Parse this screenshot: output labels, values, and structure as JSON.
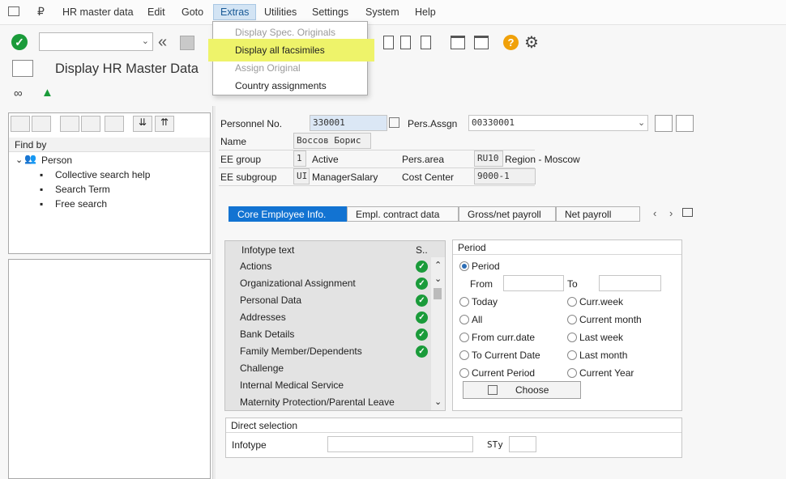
{
  "menubar": {
    "items": [
      "HR master data",
      "Edit",
      "Goto",
      "Extras",
      "Utilities",
      "Settings",
      "System",
      "Help"
    ]
  },
  "title": "Display HR Master Data",
  "extras_menu": {
    "items": [
      {
        "label": "Display Spec. Originals",
        "enabled": false
      },
      {
        "label": "Display all facsimiles",
        "enabled": true,
        "highlighted": true
      },
      {
        "label": "Assign Original",
        "enabled": false
      },
      {
        "label": "Country assignments",
        "enabled": true
      }
    ]
  },
  "left": {
    "find_by": "Find by",
    "tree": {
      "root": "Person",
      "children": [
        "Collective search help",
        "Search Term",
        "Free search"
      ]
    }
  },
  "header": {
    "personnel_no_label": "Personnel No.",
    "personnel_no": "330001",
    "pers_assgn_label": "Pers.Assgn",
    "pers_assgn": "00330001",
    "name_label": "Name",
    "name": "Воссов Борис",
    "ee_group_label": "EE group",
    "ee_group": "1",
    "ee_group_text": "Active",
    "pers_area_label": "Pers.area",
    "pers_area": "RU10",
    "pers_area_text": "Region - Moscow",
    "ee_subgroup_label": "EE subgroup",
    "ee_subgroup": "UI",
    "ee_subgroup_text": "ManagerSalary",
    "cost_center_label": "Cost Center",
    "cost_center": "9000-1"
  },
  "tabs": [
    "Core Employee Info.",
    "Empl. contract data",
    "Gross/net payroll",
    "Net payroll"
  ],
  "infotypes": {
    "col_text": "Infotype text",
    "col_s": "S..",
    "rows": [
      {
        "text": "Actions",
        "checked": true
      },
      {
        "text": "Organizational Assignment",
        "checked": true
      },
      {
        "text": "Personal Data",
        "checked": true
      },
      {
        "text": "Addresses",
        "checked": true
      },
      {
        "text": "Bank Details",
        "checked": true
      },
      {
        "text": "Family Member/Dependents",
        "checked": true
      },
      {
        "text": "Challenge",
        "checked": false
      },
      {
        "text": "Internal Medical Service",
        "checked": false
      },
      {
        "text": "Maternity Protection/Parental Leave",
        "checked": false
      }
    ]
  },
  "period": {
    "title": "Period",
    "period_label": "Period",
    "from_label": "From",
    "to_label": "To",
    "from_value": "",
    "to_value": "",
    "options_left": [
      "Today",
      "All",
      "From curr.date",
      "To Current Date",
      "Current Period"
    ],
    "options_right": [
      "Curr.week",
      "Current month",
      "Last week",
      "Last month",
      "Current Year"
    ],
    "choose_label": "Choose"
  },
  "direct": {
    "title": "Direct selection",
    "infotype_label": "Infotype",
    "sty_label": "STy",
    "infotype_value": "",
    "sty_value": ""
  },
  "colors": {
    "accent": "#1273d2",
    "highlight": "#eef36a",
    "ok_green": "#1a9b3a"
  }
}
